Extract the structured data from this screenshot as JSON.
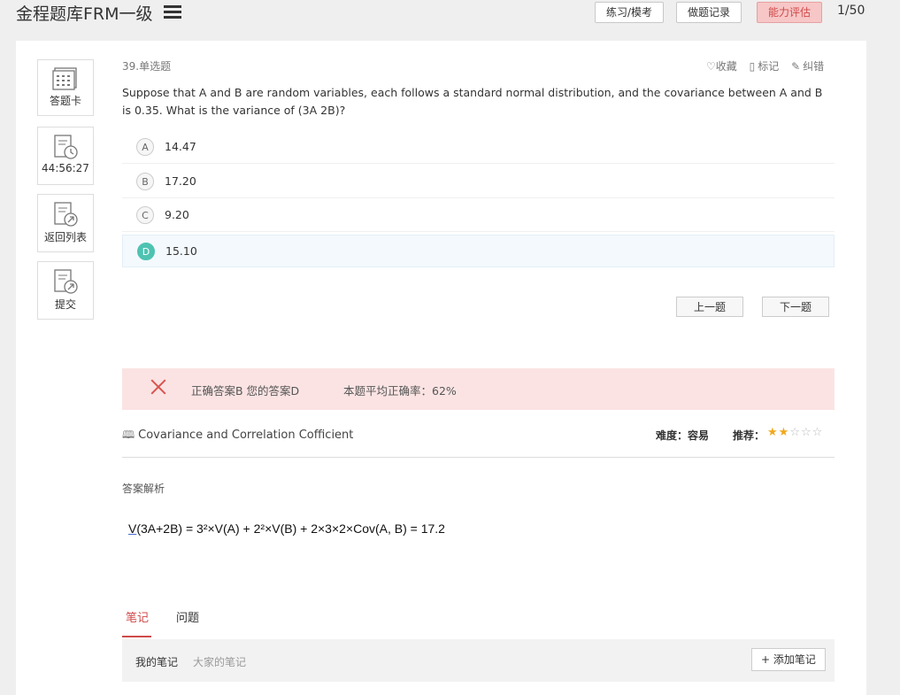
{
  "header": {
    "title": "金程题库FRM一级",
    "buttons": {
      "practice": "练习/模考",
      "records": "做题记录",
      "assessment": "能力评估"
    },
    "counter": "1/50"
  },
  "sidebar": {
    "answer_card": "答题卡",
    "timer": "44:56:27",
    "back_to_list": "返回列表",
    "submit": "提交"
  },
  "question": {
    "type": "39.单选题",
    "actions": {
      "favorite": "收藏",
      "mark": "标记",
      "report": "纠错"
    },
    "text": "Suppose that A and B are random variables, each follows a standard normal distribution, and the covariance between A and B is 0.35. What is the variance of (3A 2B)?",
    "options": [
      {
        "letter": "A",
        "text": "14.47"
      },
      {
        "letter": "B",
        "text": "17.20"
      },
      {
        "letter": "C",
        "text": "9.20"
      },
      {
        "letter": "D",
        "text": "15.10"
      }
    ],
    "selected": "D",
    "nav": {
      "prev": "上一题",
      "next": "下一题"
    }
  },
  "result": {
    "answers": "正确答案B 您的答案D",
    "accuracy": "本题平均正确率：62%"
  },
  "meta": {
    "topic": "Covariance and Correlation Cofficient",
    "difficulty": "难度：容易",
    "recommend_label": "推荐：",
    "stars_filled": 2,
    "stars_total": 5
  },
  "analysis": {
    "label": "答案解析",
    "formula_prefix": "V",
    "formula_rest": "(3A+2B) = 3²×V(A) + 2²×V(B) + 2×3×2×Cov(A, B) = 17.2"
  },
  "notes": {
    "tabs": [
      "笔记",
      "问题"
    ],
    "my_notes": "我的笔记",
    "everyone_notes": "大家的笔记",
    "add_note": "+ 添加笔记"
  },
  "colors": {
    "accent_red": "#d04a4a",
    "selected_green": "#4ec3b1",
    "star": "#f0a81e"
  }
}
